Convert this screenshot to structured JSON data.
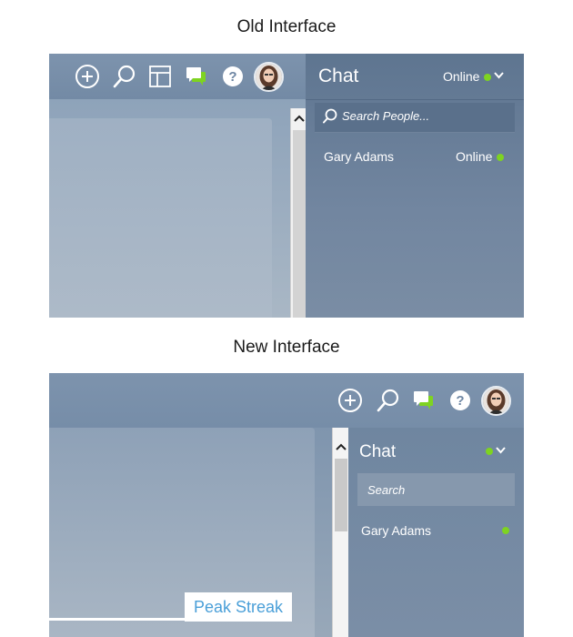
{
  "old_interface": {
    "heading": "Old Interface",
    "toolbar_icons": [
      "add-icon",
      "search-icon",
      "layout-icon",
      "chat-icon",
      "help-icon",
      "avatar"
    ],
    "chat": {
      "title": "Chat",
      "status": "Online",
      "search_placeholder": "Search People...",
      "contacts": [
        {
          "name": "Gary Adams",
          "status": "Online"
        }
      ]
    }
  },
  "new_interface": {
    "heading": "New Interface",
    "toolbar_icons": [
      "add-icon",
      "search-icon",
      "chat-icon",
      "help-icon",
      "avatar"
    ],
    "peak_streak_label": "Peak Streak",
    "chat": {
      "title": "Chat",
      "search_placeholder": "Search",
      "contacts": [
        {
          "name": "Gary Adams"
        }
      ]
    }
  },
  "colors": {
    "online": "#7ed321",
    "panel_bg": "#7d93ad",
    "chat_bg": "#6f86a0",
    "streak_text": "#4a9fd8"
  }
}
